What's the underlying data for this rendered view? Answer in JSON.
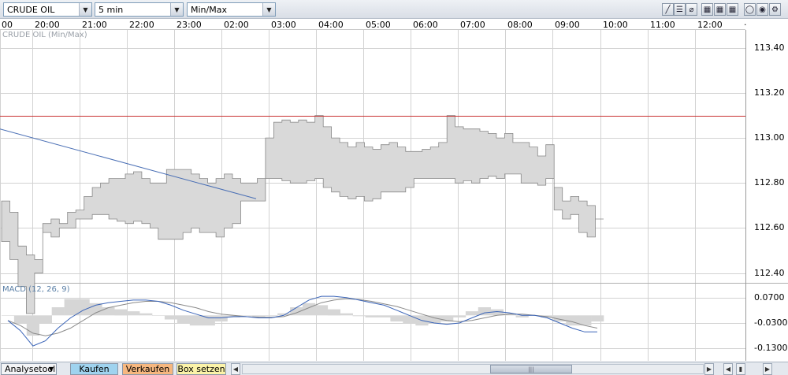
{
  "toolbar": {
    "symbol": "CRUDE OIL",
    "interval": "5 min",
    "chart_type": "Min/Max",
    "buttons": [
      {
        "name": "draw-line-icon",
        "glyph": "╱"
      },
      {
        "name": "horizontal-lines-icon",
        "glyph": "☰"
      },
      {
        "name": "fibonacci-icon",
        "glyph": "⌀"
      },
      {
        "name": "grid-one-icon",
        "glyph": "▦"
      },
      {
        "name": "grid-two-icon",
        "glyph": "▦"
      },
      {
        "name": "grid-three-icon",
        "glyph": "▦"
      },
      {
        "name": "circle-icon",
        "glyph": "◯"
      },
      {
        "name": "color-wheel-icon",
        "glyph": "◉"
      },
      {
        "name": "settings-icon",
        "glyph": "⚙"
      }
    ]
  },
  "time_axis": [
    "00",
    "20:00",
    "21:00",
    "22:00",
    "23:00",
    "02:00",
    "03:00",
    "04:00",
    "05:00",
    "06:00",
    "07:00",
    "08:00",
    "09:00",
    "10:00",
    "11:00",
    "12:00",
    "·"
  ],
  "main_panel": {
    "title": "CRUDE OIL (Min/Max)",
    "price_labels": [
      "113.40",
      "113.20",
      "113.00",
      "112.80",
      "112.60",
      "112.40"
    ],
    "reference_line": 113.1
  },
  "macd_panel": {
    "title": "MACD (12, 26, 9)",
    "labels": [
      "0.0700",
      "-0.0300",
      "-0.1300"
    ]
  },
  "bottom_bar": {
    "analysetool": "Analysetool",
    "kaufen": "Kaufen",
    "verkaufen": "Verkaufen",
    "box_setzen": "Box setzen",
    "scroll_thumb": "|||"
  },
  "colors": {
    "band_fill": "#d9d9d9",
    "band_stroke": "#888888",
    "reference_line": "#c83232",
    "trendline": "#4a6fb5",
    "macd_line": "#3a64b8",
    "signal_line": "#8a8a8a",
    "grid": "#d2d2d2",
    "kaufen": "#9fd3ef",
    "verkaufen": "#f6b77f",
    "box_setzen": "#fbf3a8"
  },
  "chart_data": {
    "type": "area",
    "series": [
      {
        "name": "Max",
        "values": [
          112.72,
          112.67,
          112.52,
          112.48,
          112.46,
          112.62,
          112.64,
          112.62,
          112.67,
          112.68,
          112.74,
          112.78,
          112.8,
          112.82,
          112.82,
          112.84,
          112.85,
          112.82,
          112.8,
          112.8,
          112.86,
          112.86,
          112.86,
          112.84,
          112.82,
          112.8,
          112.82,
          112.84,
          112.82,
          112.8,
          112.8,
          112.82,
          113.0,
          113.07,
          113.08,
          113.07,
          113.08,
          113.07,
          113.1,
          113.05,
          113.0,
          112.98,
          112.96,
          112.98,
          112.96,
          112.95,
          112.97,
          112.98,
          112.96,
          112.94,
          112.94,
          112.95,
          112.96,
          112.98,
          113.1,
          113.05,
          113.04,
          113.04,
          113.03,
          113.02,
          113.0,
          113.02,
          112.98,
          112.98,
          112.96,
          112.92,
          112.97,
          112.78,
          112.72,
          112.74,
          112.72,
          112.7,
          112.64
        ]
      },
      {
        "name": "Min",
        "values": [
          112.54,
          112.46,
          112.34,
          112.22,
          112.4,
          112.58,
          112.56,
          112.6,
          112.6,
          112.64,
          112.64,
          112.66,
          112.66,
          112.64,
          112.63,
          112.62,
          112.63,
          112.62,
          112.6,
          112.55,
          112.55,
          112.55,
          112.58,
          112.6,
          112.58,
          112.58,
          112.56,
          112.6,
          112.62,
          112.72,
          112.72,
          112.72,
          112.82,
          112.82,
          112.81,
          112.8,
          112.8,
          112.81,
          112.82,
          112.78,
          112.76,
          112.74,
          112.73,
          112.74,
          112.72,
          112.73,
          112.76,
          112.76,
          112.76,
          112.78,
          112.82,
          112.82,
          112.82,
          112.82,
          112.82,
          112.8,
          112.81,
          112.8,
          112.82,
          112.83,
          112.82,
          112.84,
          112.84,
          112.8,
          112.8,
          112.79,
          112.82,
          112.68,
          112.64,
          112.66,
          112.58,
          112.56,
          112.64
        ]
      }
    ],
    "trendline": {
      "x": [
        "19:40",
        "02:30"
      ],
      "y": [
        113.04,
        112.73
      ]
    },
    "macd": {
      "macd": [
        -0.02,
        -0.06,
        -0.12,
        -0.1,
        -0.05,
        -0.01,
        0.02,
        0.04,
        0.05,
        0.055,
        0.06,
        0.06,
        0.055,
        0.04,
        0.02,
        0.005,
        -0.01,
        -0.01,
        -0.005,
        -0.005,
        -0.01,
        -0.01,
        0.0,
        0.03,
        0.06,
        0.075,
        0.075,
        0.07,
        0.06,
        0.05,
        0.04,
        0.02,
        0.0,
        -0.02,
        -0.03,
        -0.035,
        -0.03,
        -0.01,
        0.01,
        0.015,
        0.01,
        0.0,
        0.0,
        -0.01,
        -0.03,
        -0.05,
        -0.065,
        -0.065
      ],
      "signal": [
        -0.02,
        -0.04,
        -0.07,
        -0.08,
        -0.07,
        -0.05,
        -0.02,
        0.01,
        0.03,
        0.04,
        0.05,
        0.055,
        0.055,
        0.05,
        0.04,
        0.03,
        0.015,
        0.005,
        0.0,
        -0.005,
        -0.007,
        -0.008,
        -0.005,
        0.01,
        0.03,
        0.05,
        0.06,
        0.065,
        0.062,
        0.055,
        0.045,
        0.035,
        0.02,
        0.005,
        -0.01,
        -0.02,
        -0.025,
        -0.02,
        -0.01,
        0.0,
        0.005,
        0.005,
        0.0,
        -0.005,
        -0.015,
        -0.025,
        -0.04,
        -0.05
      ]
    },
    "ylim": [
      112.36,
      113.48
    ],
    "macd_ylim": [
      -0.16,
      0.1
    ],
    "grid": true
  }
}
